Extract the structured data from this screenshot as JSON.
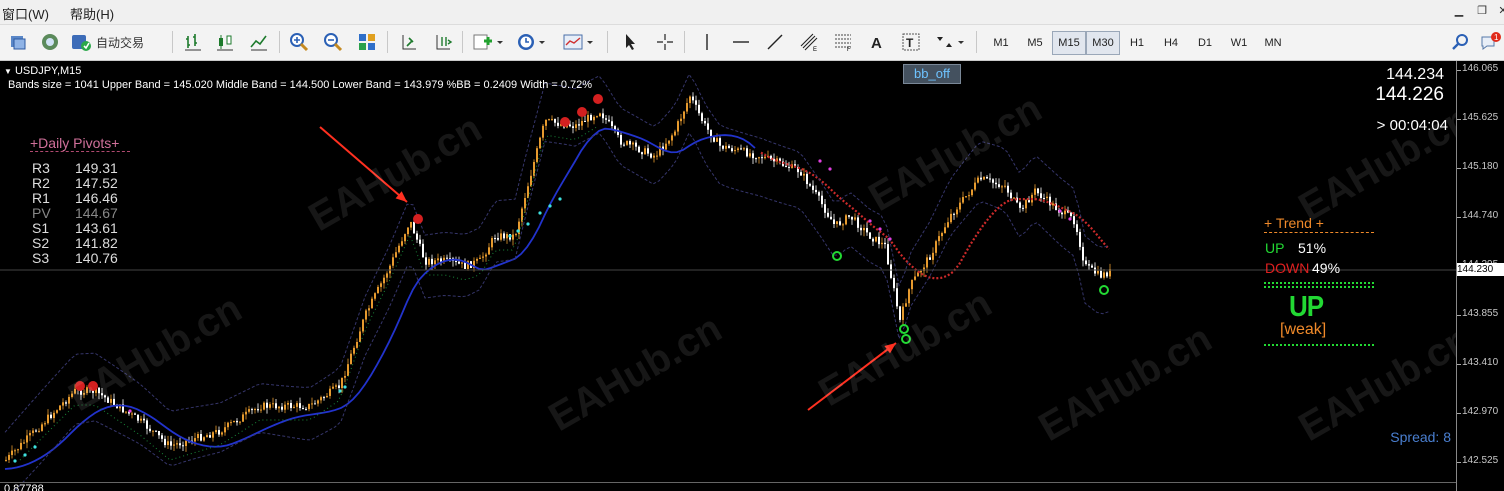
{
  "menu": {
    "window": "窗口(W)",
    "help": "帮助(H)"
  },
  "toolbar": {
    "auto_trading": "自动交易",
    "timeframes": [
      "M1",
      "M5",
      "M15",
      "M30",
      "H1",
      "H4",
      "D1",
      "W1",
      "MN"
    ],
    "active_timeframe": "M15"
  },
  "chart": {
    "symbol_title": "USDJPY,M15",
    "indicator_line": "Bands size = 1041 Upper Band = 145.020 Middle Band = 144.500 Lower Band = 143.979 %BB = 0.2409 Width = 0.72%",
    "bb_button": "bb_off",
    "price_big_top": "144.234",
    "price_big_bottom": "144.226",
    "countdown": "> 00:04:04",
    "current_price_tag": "144.230",
    "price_axis": [
      "146.065",
      "145.625",
      "145.180",
      "144.740",
      "144.295",
      "143.855",
      "143.410",
      "142.970",
      "142.525"
    ],
    "pivots": {
      "title": "+Daily Pivots+",
      "rows": [
        {
          "label": "R3",
          "value": "149.31"
        },
        {
          "label": "R2",
          "value": "147.52"
        },
        {
          "label": "R1",
          "value": "146.46"
        },
        {
          "label": "PV",
          "value": "144.67"
        },
        {
          "label": "S1",
          "value": "143.61"
        },
        {
          "label": "S2",
          "value": "141.82"
        },
        {
          "label": "S3",
          "value": "140.76"
        }
      ]
    },
    "trend": {
      "title": "+  Trend  +",
      "up_label": "UP",
      "up_value": "51%",
      "down_label": "DOWN",
      "down_value": "49%",
      "direction": "UP",
      "strength": "[weak]"
    },
    "spread": "Spread: 8",
    "bottom_partial": "0.87788",
    "watermark": "EAHub.cn",
    "colors": {
      "bull": "#e69a2e",
      "bear": "#ffffff",
      "upper_band": "#35356a",
      "ma_blue": "#2233cc",
      "dotted_red": "#cc2a2a",
      "up_green": "#22d933",
      "down_red": "#e02020",
      "trend_orange": "#f08a2a",
      "spread_blue": "#4a7fd0",
      "axis_text": "#c8c8c8"
    }
  }
}
